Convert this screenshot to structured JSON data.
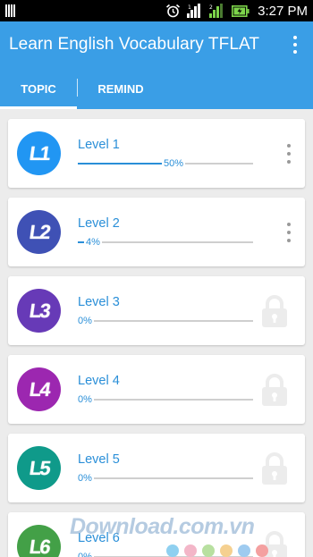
{
  "status_bar": {
    "time": "3:27 PM"
  },
  "app_bar": {
    "title": "Learn English Vocabulary TFLAT"
  },
  "tabs": [
    {
      "label": "TOPIC",
      "active": true
    },
    {
      "label": "REMIND",
      "active": false
    }
  ],
  "levels": [
    {
      "badge": "L1",
      "title": "Level 1",
      "progress_label": "50%",
      "progress": 50,
      "color": "#2196f3",
      "state": "unlocked"
    },
    {
      "badge": "L2",
      "title": "Level 2",
      "progress_label": "4%",
      "progress": 4,
      "color": "#3f51b5",
      "state": "unlocked"
    },
    {
      "badge": "L3",
      "title": "Level 3",
      "progress_label": "0%",
      "progress": 0,
      "color": "#673ab7",
      "state": "locked"
    },
    {
      "badge": "L4",
      "title": "Level 4",
      "progress_label": "0%",
      "progress": 0,
      "color": "#9c27b0",
      "state": "locked"
    },
    {
      "badge": "L5",
      "title": "Level 5",
      "progress_label": "0%",
      "progress": 0,
      "color": "#0f9a8a",
      "state": "locked"
    },
    {
      "badge": "L6",
      "title": "Level 6",
      "progress_label": "0%",
      "progress": 0,
      "color": "#43a047",
      "state": "locked"
    }
  ],
  "watermark": {
    "text": "Download.com.vn",
    "dot_colors": [
      "#8fd0f0",
      "#f3b6c8",
      "#b8e0a0",
      "#f5d090",
      "#9ecbf0",
      "#f4a0a0"
    ]
  }
}
